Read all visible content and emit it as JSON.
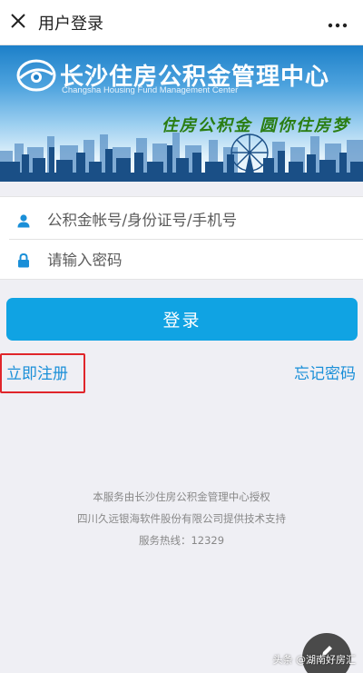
{
  "topbar": {
    "title": "用户登录",
    "close_icon": "close-icon",
    "more_icon": "more-horizontal-icon"
  },
  "banner": {
    "org_name_cn": "长沙住房公积金管理中心",
    "org_name_en": "Changsha Housing Fund Management Center",
    "slogan": "住房公积金  圆你住房梦",
    "logo_icon": "eye-logo-icon",
    "colors": {
      "sky_top": "#1d80c9",
      "skyline": "#1a4f86"
    }
  },
  "form": {
    "account_placeholder": "公积金帐号/身份证号/手机号",
    "password_placeholder": "请输入密码",
    "account_icon": "user-icon",
    "password_icon": "lock-icon",
    "icon_color": "#1a8fd8"
  },
  "actions": {
    "login_label": "登录",
    "register_label": "立即注册",
    "forgot_label": "忘记密码",
    "accent": "#10a3e3",
    "highlight_border": "#e0252a"
  },
  "footer": {
    "line1": "本服务由长沙住房公积金管理中心授权",
    "line2": "四川久远银海软件股份有限公司提供技术支持",
    "line3": "服务热线：12329"
  },
  "overlay": {
    "watermark": "头条 @湖南好房汇",
    "fab_icon": "pencil-icon"
  }
}
